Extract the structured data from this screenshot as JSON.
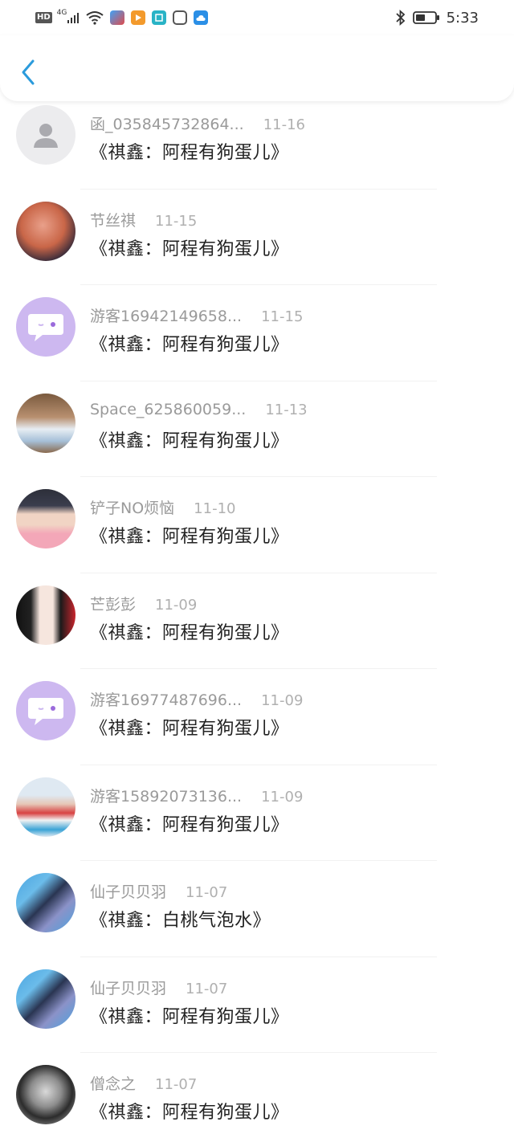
{
  "status_bar": {
    "hd": "HD",
    "network": "4G",
    "time": "5:33",
    "icons": [
      "signal-icon",
      "wifi-icon",
      "app-icon-blue",
      "app-icon-orange",
      "app-icon-teal",
      "app-icon-hex",
      "app-icon-cloud",
      "bluetooth-icon",
      "battery-icon"
    ]
  },
  "header": {
    "back_icon": "chevron-left-icon",
    "accent": "#2b9bdc"
  },
  "comments": [
    {
      "user": "函_035845732864...",
      "date": "11-16",
      "title": "《祺鑫：阿程有狗蛋儿》",
      "avatar": "default-avatar"
    },
    {
      "user": "节丝祺",
      "date": "11-15",
      "title": "《祺鑫：阿程有狗蛋儿》",
      "avatar": "photo-avatar"
    },
    {
      "user": "游客16942149658...",
      "date": "11-15",
      "title": "《祺鑫：阿程有狗蛋儿》",
      "avatar": "guest-avatar"
    },
    {
      "user": "Space_625860059...",
      "date": "11-13",
      "title": "《祺鑫：阿程有狗蛋儿》",
      "avatar": "photo-avatar"
    },
    {
      "user": "铲子NO烦恼",
      "date": "11-10",
      "title": "《祺鑫：阿程有狗蛋儿》",
      "avatar": "photo-avatar"
    },
    {
      "user": "芒彭彭",
      "date": "11-09",
      "title": "《祺鑫：阿程有狗蛋儿》",
      "avatar": "anime-avatar"
    },
    {
      "user": "游客16977487696...",
      "date": "11-09",
      "title": "《祺鑫：阿程有狗蛋儿》",
      "avatar": "guest-avatar"
    },
    {
      "user": "游客15892073136...",
      "date": "11-09",
      "title": "《祺鑫：阿程有狗蛋儿》",
      "avatar": "photo-avatar"
    },
    {
      "user": "仙子贝贝羽",
      "date": "11-07",
      "title": "《祺鑫：白桃气泡水》",
      "avatar": "photo-avatar"
    },
    {
      "user": "仙子贝贝羽",
      "date": "11-07",
      "title": "《祺鑫：阿程有狗蛋儿》",
      "avatar": "photo-avatar"
    },
    {
      "user": "僧念之",
      "date": "11-07",
      "title": "《祺鑫：阿程有狗蛋儿》",
      "avatar": "photo-avatar"
    }
  ]
}
